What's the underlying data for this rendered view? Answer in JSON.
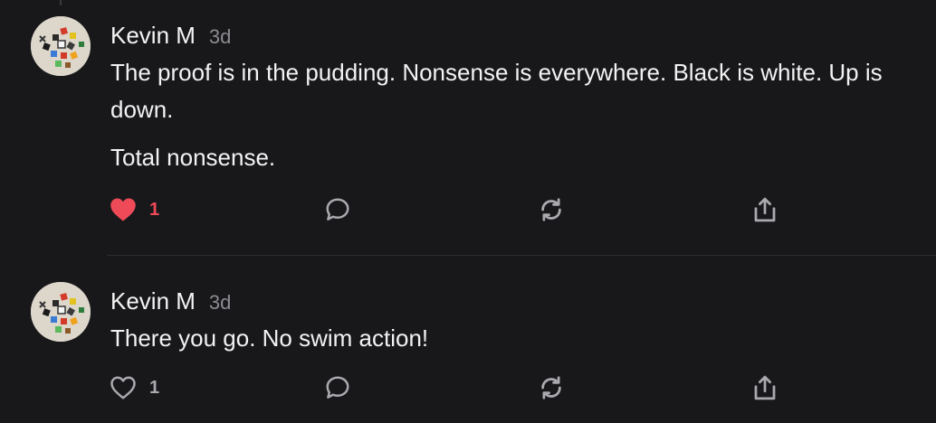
{
  "comments": [
    {
      "author": "Kevin M",
      "time": "3d",
      "paragraphs": [
        "The proof is in the pudding. Nonsense is everywhere. Black is white. Up is down.",
        "Total nonsense."
      ],
      "liked": true,
      "like_count": "1"
    },
    {
      "author": "Kevin M",
      "time": "3d",
      "paragraphs": [
        "There you go. No swim action!"
      ],
      "liked": false,
      "like_count": "1"
    }
  ],
  "icons": {
    "like_filled": "heart-filled-icon",
    "like_outline": "heart-outline-icon",
    "reply": "speech-bubble-icon",
    "repost": "repost-arrows-icon",
    "share": "share-upload-icon"
  },
  "colors": {
    "background": "#18181b",
    "text": "#f2f2f2",
    "muted": "#8b8b90",
    "liked": "#ee4a58",
    "icon": "#a9a9ae",
    "divider": "#2d2d31"
  }
}
